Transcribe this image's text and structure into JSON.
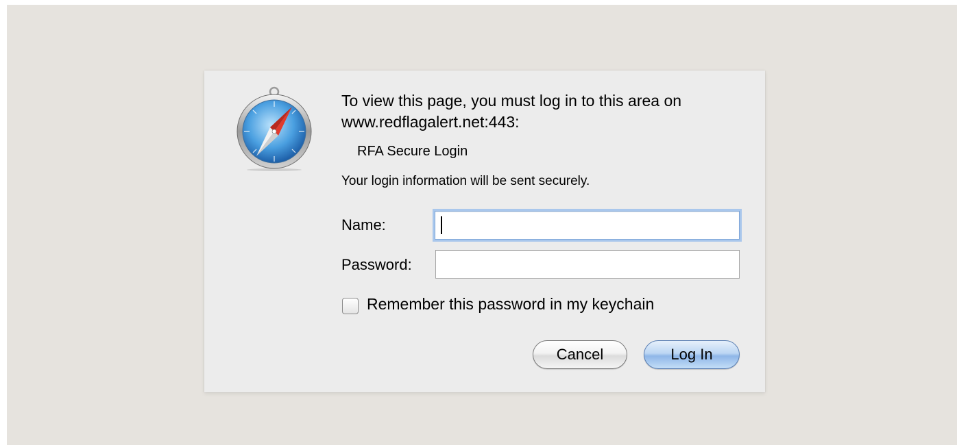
{
  "dialog": {
    "message": "To view this page, you must log in to this area on www.redflagalert.net:443:",
    "realm": "RFA Secure Login",
    "secure_note": "Your login information will be sent securely.",
    "app_icon": "safari-compass-icon"
  },
  "form": {
    "name_label": "Name:",
    "name_value": "",
    "password_label": "Password:",
    "password_value": "",
    "remember_label": "Remember this password in my keychain",
    "remember_checked": false
  },
  "buttons": {
    "cancel_label": "Cancel",
    "login_label": "Log In"
  },
  "colors": {
    "backdrop": "#e6e3de",
    "dialog": "#ececec",
    "focus_ring": "#a9c7ec",
    "default_button": "#8fb7e8"
  }
}
